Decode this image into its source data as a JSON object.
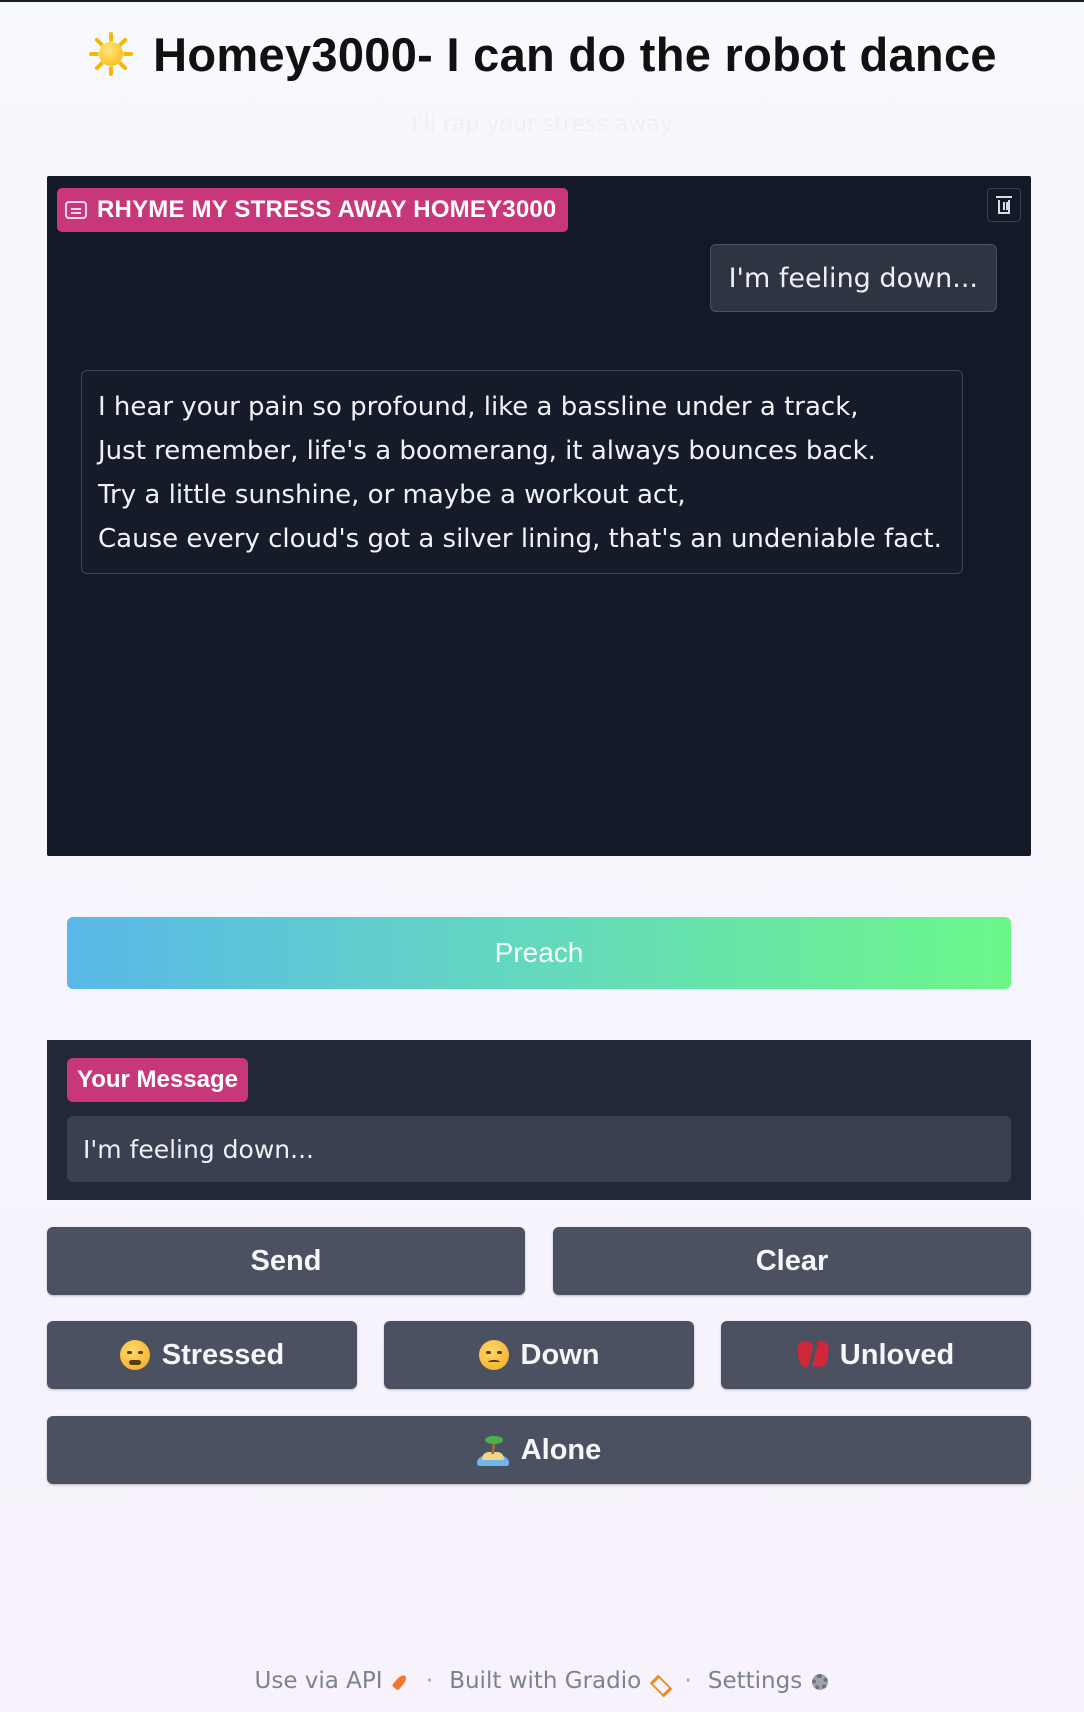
{
  "header": {
    "title": "Homey3000- I can do the robot dance",
    "subtitle": "I'll rap your stress away"
  },
  "chatbot": {
    "label": "RHYME MY STRESS AWAY HOMEY3000",
    "messages": [
      {
        "role": "user",
        "text": "I'm feeling down..."
      },
      {
        "role": "bot",
        "lines": [
          "I hear your pain so profound, like a bassline under a track,",
          "Just remember, life's a boomerang, it always bounces back.",
          "Try a little sunshine, or maybe a workout act,",
          "Cause every cloud's got a silver lining, that's an undeniable fact."
        ]
      }
    ]
  },
  "preach_button": {
    "label": "Preach"
  },
  "message_box": {
    "label": "Your Message",
    "value": "I'm feeling down..."
  },
  "buttons": {
    "send": "Send",
    "clear": "Clear",
    "stressed": "Stressed",
    "down": "Down",
    "unloved": "Unloved",
    "alone": "Alone"
  },
  "footer": {
    "api": "Use via API",
    "built": "Built with Gradio",
    "settings": "Settings",
    "separator": "·"
  },
  "colors": {
    "accent": "#c8377a",
    "panel": "#141927",
    "button": "#4b5161",
    "preach_gradient_start": "#59b8e8",
    "preach_gradient_end": "#6cf789"
  }
}
